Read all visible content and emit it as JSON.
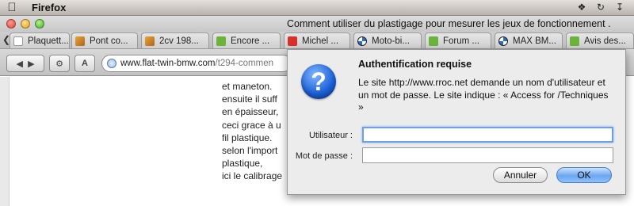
{
  "menubar": {
    "app_name": "Firefox",
    "icons": [
      "apple-icon",
      "dropbox-icon",
      "sync-icon",
      "download-icon"
    ]
  },
  "window": {
    "title": "Comment utiliser du plastigage pour mesurer les jeux de fonctionnement ."
  },
  "tabs": [
    {
      "label": "Plaquett...",
      "icon": "page-icon"
    },
    {
      "label": "Pont co...",
      "icon": "cube-icon"
    },
    {
      "label": "2cv 198...",
      "icon": "cube-icon"
    },
    {
      "label": "Encore ...",
      "icon": "bubble-icon"
    },
    {
      "label": "Michel ...",
      "icon": "red-logo-icon"
    },
    {
      "label": "Moto-bi...",
      "icon": "bmw-icon"
    },
    {
      "label": "Forum ...",
      "icon": "bubble-icon"
    },
    {
      "label": "MAX BM...",
      "icon": "bmw-icon"
    },
    {
      "label": "Avis des...",
      "icon": "bubble-icon"
    }
  ],
  "navbar": {
    "url_host": "www.flat-twin-bmw.com",
    "url_path": "/t294-commen"
  },
  "page": {
    "lines": [
      "et maneton.",
      "ensuite il suff",
      "en épaisseur,",
      "ceci grace à u",
      "fil plastique.",
      "selon l'import",
      "plastique,",
      "ici le calibrage"
    ]
  },
  "dialog": {
    "title": "Authentification requise",
    "message": "Le site http://www.rroc.net demande un nom d'utilisateur et un mot de passe. Le site indique : « Access for /Techniques »",
    "username_label": "Utilisateur :",
    "username_value": "",
    "password_label": "Mot de passe :",
    "password_value": "",
    "cancel_label": "Annuler",
    "ok_label": "OK"
  }
}
